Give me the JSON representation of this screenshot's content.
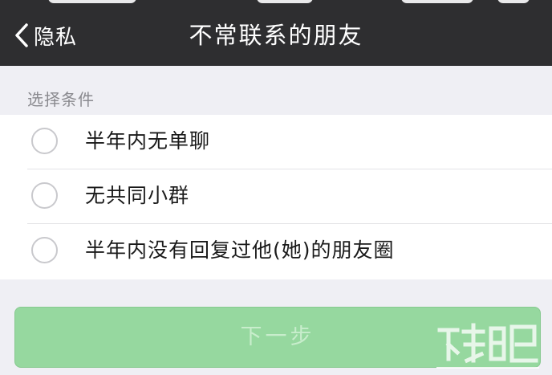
{
  "navbar": {
    "back_label": "隐私",
    "title": "不常联系的朋友",
    "background": "#2e2e30"
  },
  "section": {
    "header": "选择条件"
  },
  "options": [
    {
      "label": "半年内无单聊",
      "selected": false
    },
    {
      "label": "无共同小群",
      "selected": false
    },
    {
      "label": "半年内没有回复过他(她)的朋友圈",
      "selected": false
    }
  ],
  "next_button": {
    "label": "下一步",
    "enabled": false,
    "color": "#96d89f"
  },
  "icons": {
    "back": "chevron-left-icon",
    "radio": "radio-unchecked-icon"
  }
}
